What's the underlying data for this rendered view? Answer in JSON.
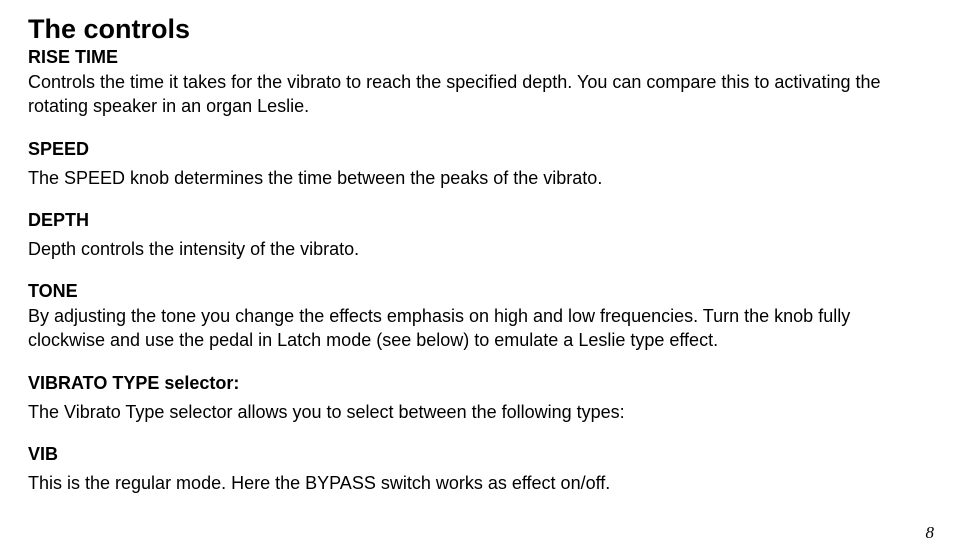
{
  "title": "The controls",
  "sections": [
    {
      "heading": "RISE TIME",
      "body": "Controls the time it takes for the vibrato to reach the specified depth. You can compare this to activating the rotating speaker in an organ Leslie."
    },
    {
      "heading": "SPEED",
      "body": "The SPEED knob determines the time between the peaks of the vibrato."
    },
    {
      "heading": "DEPTH",
      "body": "Depth controls the intensity of the vibrato."
    },
    {
      "heading": "TONE",
      "body": "By adjusting the tone you change the effects emphasis on high and low frequencies. Turn the knob fully clockwise and use the pedal in Latch mode (see below) to emulate a Leslie type effect."
    },
    {
      "heading": "VIBRATO TYPE selector:",
      "body": "The Vibrato Type selector allows you to select between the following types:"
    },
    {
      "heading": "VIB",
      "body": "This is the regular mode. Here the BYPASS switch works as effect on/off."
    }
  ],
  "page_number": "8"
}
